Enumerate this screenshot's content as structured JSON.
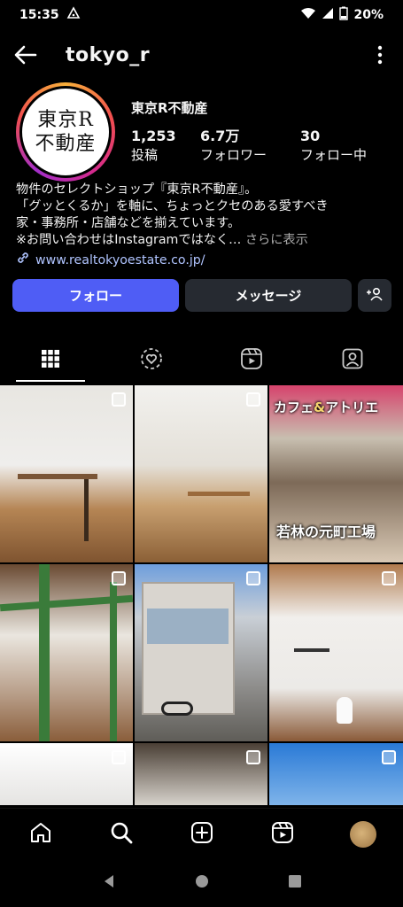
{
  "status_bar": {
    "time": "15:35",
    "battery": "20%"
  },
  "header": {
    "username": "tokyo_r"
  },
  "profile": {
    "avatar_text_line1": "東京R",
    "avatar_text_line2": "不動産",
    "display_name": "東京R不動産",
    "stats": [
      {
        "value": "1,253",
        "label": "投稿"
      },
      {
        "value": "6.7万",
        "label": "フォロワー"
      },
      {
        "value": "30",
        "label": "フォロー中"
      }
    ],
    "bio_line1": "物件のセレクトショップ『東京R不動産』。",
    "bio_line2": "「グッとくるか」を軸に、ちょっとクセのある愛すべき",
    "bio_line3": "家・事務所・店舗などを揃えています。",
    "bio_line4": "※お問い合わせはInstagramではなく…",
    "bio_more": "さらに表示",
    "link": "www.realtokyoestate.co.jp/"
  },
  "actions": {
    "follow_label": "フォロー",
    "message_label": "メッセージ"
  },
  "tabs": [
    {
      "name": "grid-icon",
      "active": true
    },
    {
      "name": "reels-heart-icon",
      "active": false
    },
    {
      "name": "reels-icon",
      "active": false
    },
    {
      "name": "tagged-icon",
      "active": false
    }
  ],
  "posts": {
    "p3_title_part1": "カフェ",
    "p3_title_amp": "&",
    "p3_title_part2": "アトリエ",
    "p3_caption": "若林の元町工場"
  },
  "bottom_nav": [
    "home-icon",
    "search-icon",
    "create-icon",
    "reels-icon",
    "profile-avatar"
  ]
}
